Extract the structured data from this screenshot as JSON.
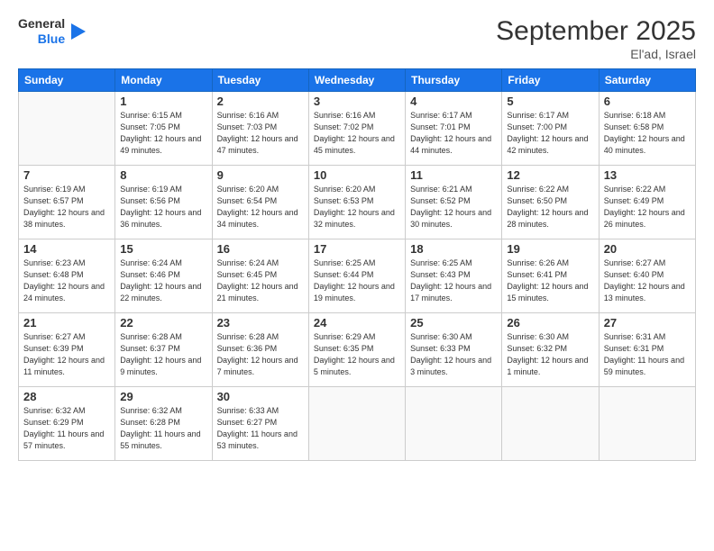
{
  "header": {
    "logo_line1": "General",
    "logo_line2": "Blue",
    "month": "September 2025",
    "location": "El'ad, Israel"
  },
  "weekdays": [
    "Sunday",
    "Monday",
    "Tuesday",
    "Wednesday",
    "Thursday",
    "Friday",
    "Saturday"
  ],
  "weeks": [
    [
      {
        "day": "",
        "sunrise": "",
        "sunset": "",
        "daylight": ""
      },
      {
        "day": "1",
        "sunrise": "6:15 AM",
        "sunset": "7:05 PM",
        "daylight": "12 hours and 49 minutes."
      },
      {
        "day": "2",
        "sunrise": "6:16 AM",
        "sunset": "7:03 PM",
        "daylight": "12 hours and 47 minutes."
      },
      {
        "day": "3",
        "sunrise": "6:16 AM",
        "sunset": "7:02 PM",
        "daylight": "12 hours and 45 minutes."
      },
      {
        "day": "4",
        "sunrise": "6:17 AM",
        "sunset": "7:01 PM",
        "daylight": "12 hours and 44 minutes."
      },
      {
        "day": "5",
        "sunrise": "6:17 AM",
        "sunset": "7:00 PM",
        "daylight": "12 hours and 42 minutes."
      },
      {
        "day": "6",
        "sunrise": "6:18 AM",
        "sunset": "6:58 PM",
        "daylight": "12 hours and 40 minutes."
      }
    ],
    [
      {
        "day": "7",
        "sunrise": "6:19 AM",
        "sunset": "6:57 PM",
        "daylight": "12 hours and 38 minutes."
      },
      {
        "day": "8",
        "sunrise": "6:19 AM",
        "sunset": "6:56 PM",
        "daylight": "12 hours and 36 minutes."
      },
      {
        "day": "9",
        "sunrise": "6:20 AM",
        "sunset": "6:54 PM",
        "daylight": "12 hours and 34 minutes."
      },
      {
        "day": "10",
        "sunrise": "6:20 AM",
        "sunset": "6:53 PM",
        "daylight": "12 hours and 32 minutes."
      },
      {
        "day": "11",
        "sunrise": "6:21 AM",
        "sunset": "6:52 PM",
        "daylight": "12 hours and 30 minutes."
      },
      {
        "day": "12",
        "sunrise": "6:22 AM",
        "sunset": "6:50 PM",
        "daylight": "12 hours and 28 minutes."
      },
      {
        "day": "13",
        "sunrise": "6:22 AM",
        "sunset": "6:49 PM",
        "daylight": "12 hours and 26 minutes."
      }
    ],
    [
      {
        "day": "14",
        "sunrise": "6:23 AM",
        "sunset": "6:48 PM",
        "daylight": "12 hours and 24 minutes."
      },
      {
        "day": "15",
        "sunrise": "6:24 AM",
        "sunset": "6:46 PM",
        "daylight": "12 hours and 22 minutes."
      },
      {
        "day": "16",
        "sunrise": "6:24 AM",
        "sunset": "6:45 PM",
        "daylight": "12 hours and 21 minutes."
      },
      {
        "day": "17",
        "sunrise": "6:25 AM",
        "sunset": "6:44 PM",
        "daylight": "12 hours and 19 minutes."
      },
      {
        "day": "18",
        "sunrise": "6:25 AM",
        "sunset": "6:43 PM",
        "daylight": "12 hours and 17 minutes."
      },
      {
        "day": "19",
        "sunrise": "6:26 AM",
        "sunset": "6:41 PM",
        "daylight": "12 hours and 15 minutes."
      },
      {
        "day": "20",
        "sunrise": "6:27 AM",
        "sunset": "6:40 PM",
        "daylight": "12 hours and 13 minutes."
      }
    ],
    [
      {
        "day": "21",
        "sunrise": "6:27 AM",
        "sunset": "6:39 PM",
        "daylight": "12 hours and 11 minutes."
      },
      {
        "day": "22",
        "sunrise": "6:28 AM",
        "sunset": "6:37 PM",
        "daylight": "12 hours and 9 minutes."
      },
      {
        "day": "23",
        "sunrise": "6:28 AM",
        "sunset": "6:36 PM",
        "daylight": "12 hours and 7 minutes."
      },
      {
        "day": "24",
        "sunrise": "6:29 AM",
        "sunset": "6:35 PM",
        "daylight": "12 hours and 5 minutes."
      },
      {
        "day": "25",
        "sunrise": "6:30 AM",
        "sunset": "6:33 PM",
        "daylight": "12 hours and 3 minutes."
      },
      {
        "day": "26",
        "sunrise": "6:30 AM",
        "sunset": "6:32 PM",
        "daylight": "12 hours and 1 minute."
      },
      {
        "day": "27",
        "sunrise": "6:31 AM",
        "sunset": "6:31 PM",
        "daylight": "11 hours and 59 minutes."
      }
    ],
    [
      {
        "day": "28",
        "sunrise": "6:32 AM",
        "sunset": "6:29 PM",
        "daylight": "11 hours and 57 minutes."
      },
      {
        "day": "29",
        "sunrise": "6:32 AM",
        "sunset": "6:28 PM",
        "daylight": "11 hours and 55 minutes."
      },
      {
        "day": "30",
        "sunrise": "6:33 AM",
        "sunset": "6:27 PM",
        "daylight": "11 hours and 53 minutes."
      },
      {
        "day": "",
        "sunrise": "",
        "sunset": "",
        "daylight": ""
      },
      {
        "day": "",
        "sunrise": "",
        "sunset": "",
        "daylight": ""
      },
      {
        "day": "",
        "sunrise": "",
        "sunset": "",
        "daylight": ""
      },
      {
        "day": "",
        "sunrise": "",
        "sunset": "",
        "daylight": ""
      }
    ]
  ]
}
